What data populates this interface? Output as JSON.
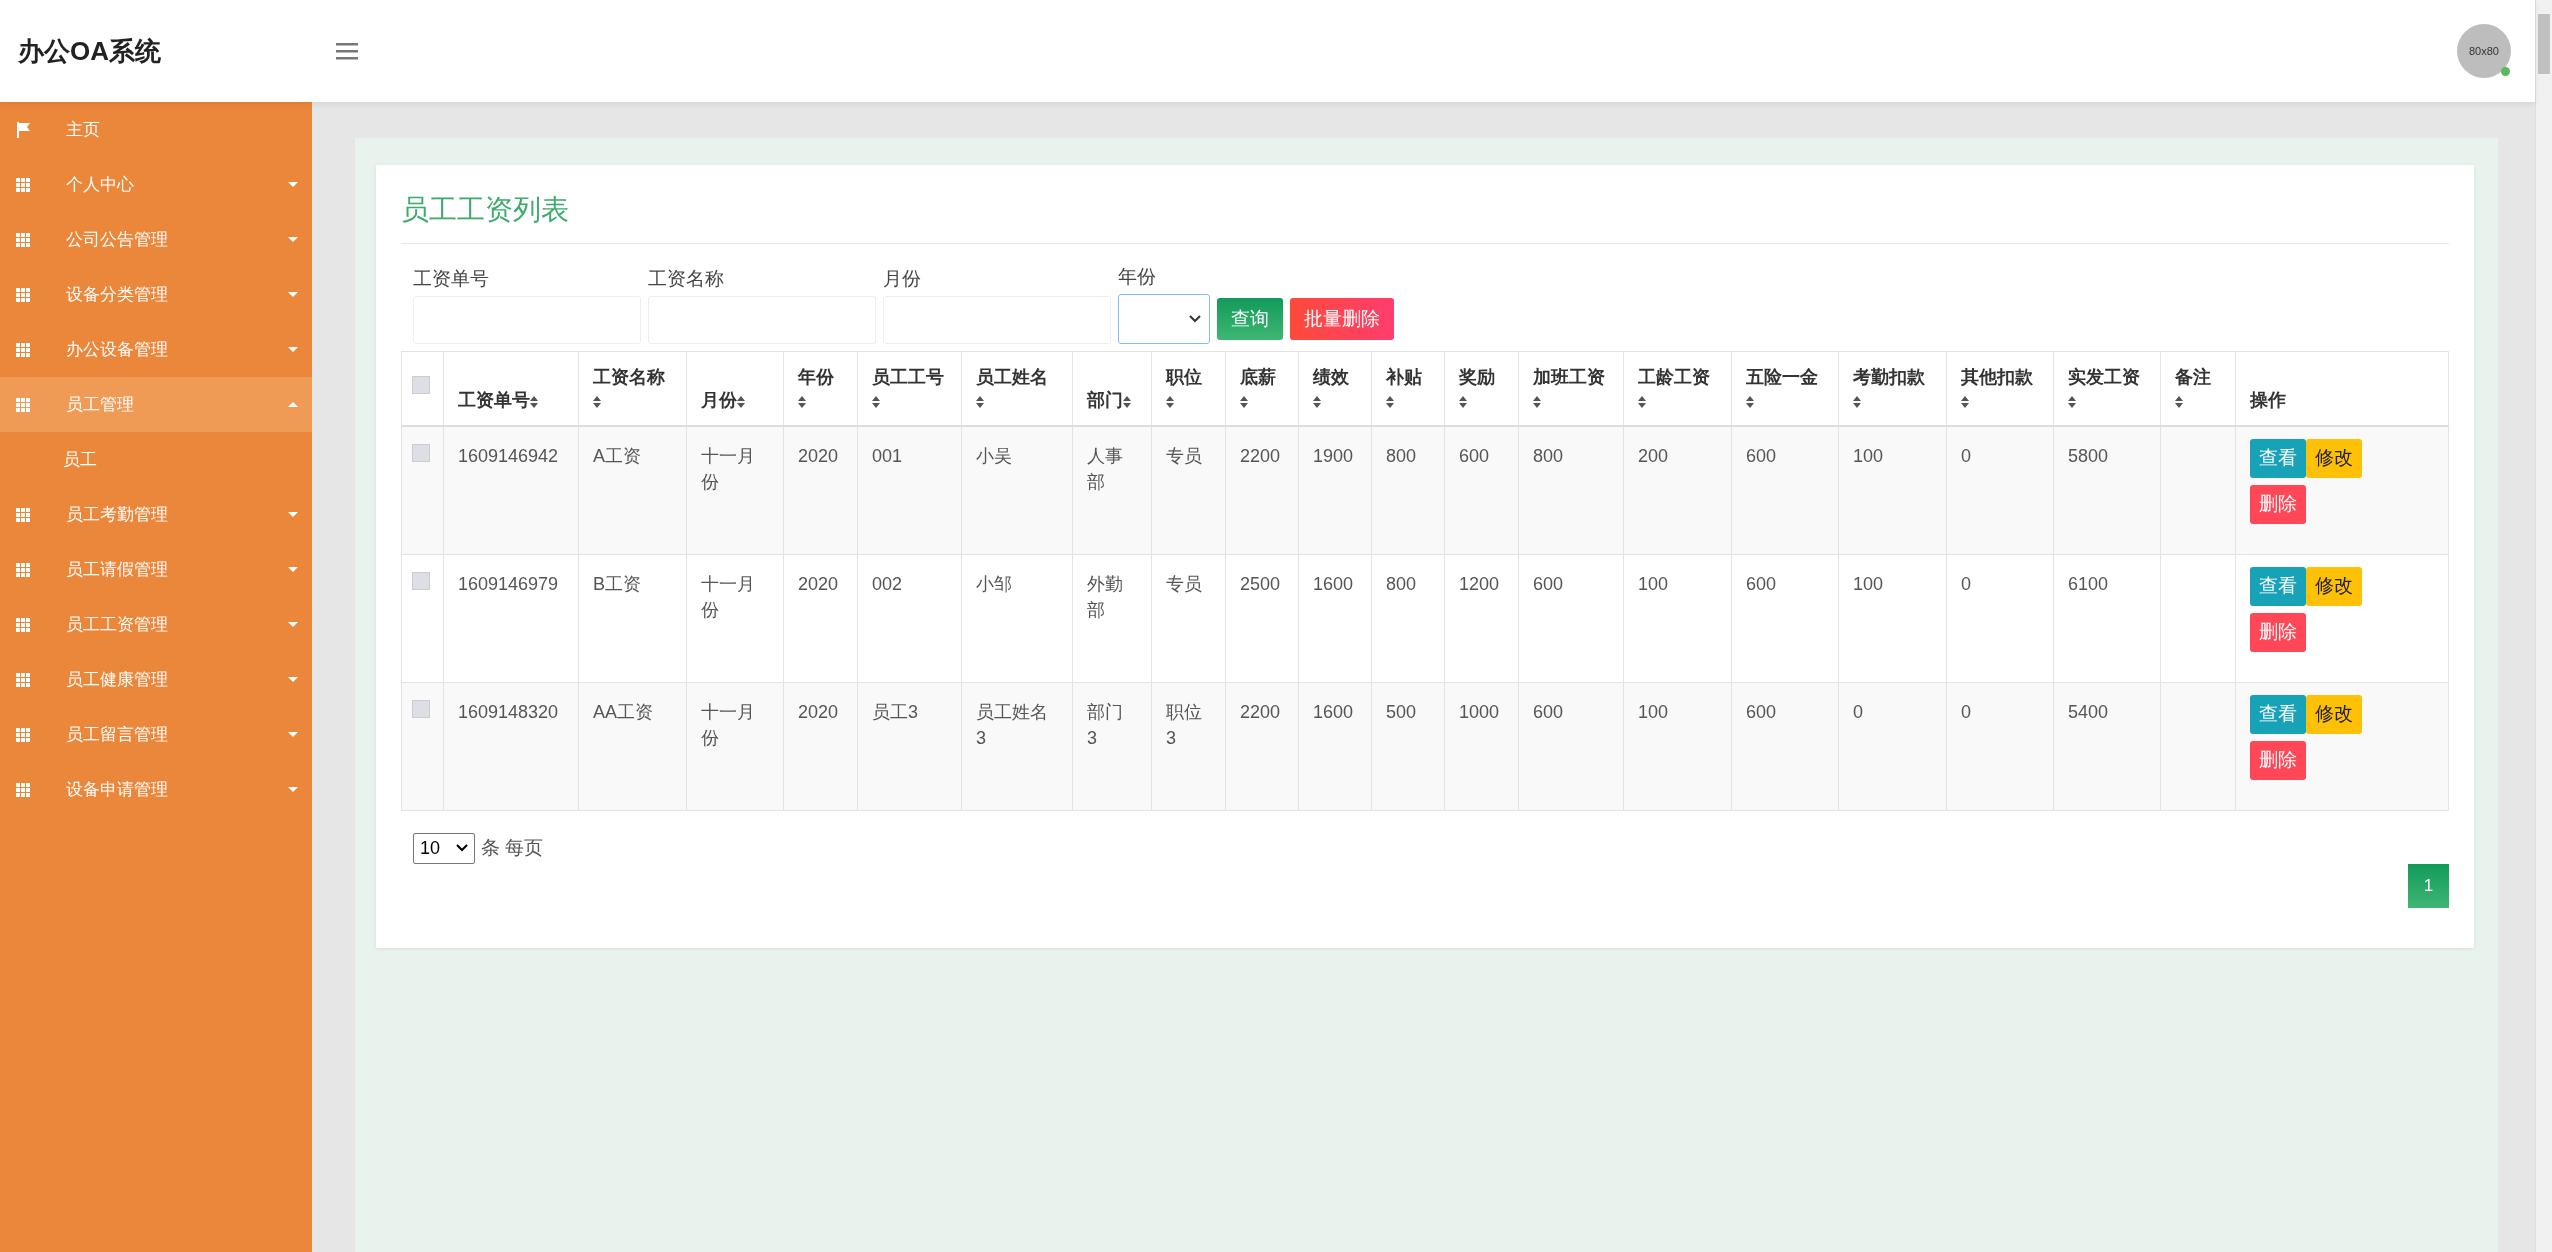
{
  "header": {
    "title": "办公OA系统",
    "avatar": {
      "label": "80x80",
      "online": true
    }
  },
  "sidebar": {
    "items": [
      {
        "label": "主页",
        "kind": "link",
        "selected": false
      },
      {
        "label": "个人中心",
        "kind": "menu",
        "expanded": false,
        "selected": false
      },
      {
        "label": "公司公告管理",
        "kind": "menu",
        "expanded": false,
        "selected": false
      },
      {
        "label": "设备分类管理",
        "kind": "menu",
        "expanded": false,
        "selected": false
      },
      {
        "label": "办公设备管理",
        "kind": "menu",
        "expanded": false,
        "selected": false
      },
      {
        "label": "员工管理",
        "kind": "menu",
        "expanded": true,
        "selected": true,
        "children": [
          {
            "label": "员工"
          }
        ]
      },
      {
        "label": "员工考勤管理",
        "kind": "menu",
        "expanded": false,
        "selected": false
      },
      {
        "label": "员工请假管理",
        "kind": "menu",
        "expanded": false,
        "selected": false
      },
      {
        "label": "员工工资管理",
        "kind": "menu",
        "expanded": false,
        "selected": false
      },
      {
        "label": "员工健康管理",
        "kind": "menu",
        "expanded": false,
        "selected": false
      },
      {
        "label": "员工留言管理",
        "kind": "menu",
        "expanded": false,
        "selected": false
      },
      {
        "label": "设备申请管理",
        "kind": "menu",
        "expanded": false,
        "selected": false
      }
    ]
  },
  "card": {
    "title": "员工工资列表",
    "filters": [
      {
        "label": "工资单号",
        "kind": "text"
      },
      {
        "label": "工资名称",
        "kind": "text"
      },
      {
        "label": "月份",
        "kind": "text"
      },
      {
        "label": "年份",
        "kind": "select"
      }
    ],
    "buttons": [
      {
        "label": "查询",
        "kind": "search"
      },
      {
        "label": "批量删除",
        "kind": "delete"
      }
    ],
    "table": {
      "all_checked": false,
      "columns": [
        {
          "label": "工资单号",
          "sortable": true
        },
        {
          "label": "工资名称",
          "sortable": true
        },
        {
          "label": "月份",
          "sortable": true
        },
        {
          "label": "年份",
          "sortable": true
        },
        {
          "label": "员工工号",
          "sortable": true
        },
        {
          "label": "员工姓名",
          "sortable": true
        },
        {
          "label": "部门",
          "sortable": true
        },
        {
          "label": "职位",
          "sortable": true
        },
        {
          "label": "底薪",
          "sortable": true
        },
        {
          "label": "绩效",
          "sortable": true
        },
        {
          "label": "补贴",
          "sortable": true
        },
        {
          "label": "奖励",
          "sortable": true
        },
        {
          "label": "加班工资",
          "sortable": true
        },
        {
          "label": "工龄工资",
          "sortable": true
        },
        {
          "label": "五险一金",
          "sortable": true
        },
        {
          "label": "考勤扣款",
          "sortable": true
        },
        {
          "label": "其他扣款",
          "sortable": true
        },
        {
          "label": "实发工资",
          "sortable": true
        },
        {
          "label": "备注",
          "sortable": true
        },
        {
          "label": "操作",
          "sortable": false
        }
      ],
      "rows": [
        {
          "checked": false,
          "cells": [
            "1609146942",
            "A工资",
            "十一月份",
            "2020",
            "001",
            "小吴",
            "人事部",
            "专员",
            "2200",
            "1900",
            "800",
            "600",
            "800",
            "200",
            "600",
            "100",
            "0",
            "5800",
            ""
          ],
          "actions": [
            {
              "label": "查看",
              "kind": "view"
            },
            {
              "label": "修改",
              "kind": "edit"
            },
            {
              "label": "删除",
              "kind": "delete"
            }
          ]
        },
        {
          "checked": false,
          "cells": [
            "1609146979",
            "B工资",
            "十一月份",
            "2020",
            "002",
            "小邹",
            "外勤部",
            "专员",
            "2500",
            "1600",
            "800",
            "1200",
            "600",
            "100",
            "600",
            "100",
            "0",
            "6100",
            ""
          ],
          "actions": [
            {
              "label": "查看",
              "kind": "view"
            },
            {
              "label": "修改",
              "kind": "edit"
            },
            {
              "label": "删除",
              "kind": "delete"
            }
          ]
        },
        {
          "checked": false,
          "cells": [
            "1609148320",
            "AA工资",
            "十一月份",
            "2020",
            "员工3",
            "员工姓名3",
            "部门3",
            "职位3",
            "2200",
            "1600",
            "500",
            "1000",
            "600",
            "100",
            "600",
            "0",
            "0",
            "5400",
            ""
          ],
          "actions": [
            {
              "label": "查看",
              "kind": "view"
            },
            {
              "label": "修改",
              "kind": "edit"
            },
            {
              "label": "删除",
              "kind": "delete"
            }
          ]
        }
      ]
    },
    "page_size": {
      "value": "10",
      "suffix": "条 每页"
    },
    "pages": [
      {
        "label": "1",
        "selected": true
      }
    ]
  }
}
